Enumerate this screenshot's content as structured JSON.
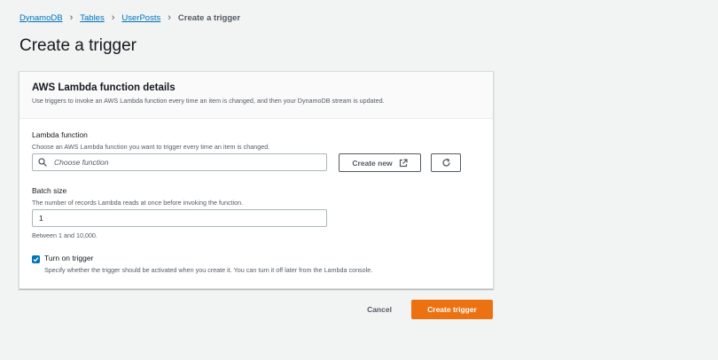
{
  "breadcrumb": {
    "items": [
      "DynamoDB",
      "Tables",
      "UserPosts"
    ],
    "current": "Create a trigger"
  },
  "page": {
    "title": "Create a trigger"
  },
  "panel": {
    "title": "AWS Lambda function details",
    "description": "Use triggers to invoke an AWS Lambda function every time an item is changed, and then your DynamoDB stream is updated.",
    "lambda": {
      "label": "Lambda function",
      "description": "Choose an AWS Lambda function you want to trigger every time an item is changed.",
      "placeholder": "Choose function",
      "create_new_label": "Create new",
      "refresh_icon": "refresh-icon",
      "external_icon": "external-link-icon"
    },
    "batch": {
      "label": "Batch size",
      "description": "The number of records Lambda reads at once before invoking the function.",
      "value": "1",
      "constraint": "Between 1 and 10,000."
    },
    "trigger": {
      "label": "Turn on trigger",
      "checked": true,
      "description": "Specify whether the trigger should be activated when you create it. You can turn it off later from the Lambda console."
    }
  },
  "footer": {
    "cancel_label": "Cancel",
    "submit_label": "Create trigger"
  },
  "colors": {
    "primary": "#ec7211",
    "link": "#0073bb",
    "background": "#f2f3f3"
  }
}
